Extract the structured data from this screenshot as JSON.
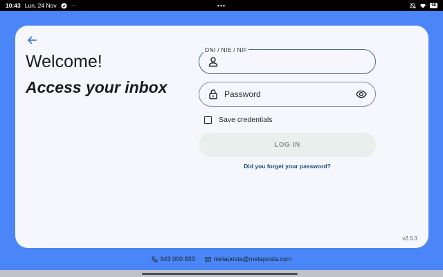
{
  "status_bar": {
    "time": "10:43",
    "date": "Lun, 24 Nov",
    "center_dots": "•••",
    "left_dots": "···",
    "battery": "98"
  },
  "welcome": {
    "title": "Welcome!",
    "subtitle": "Access your inbox"
  },
  "form": {
    "dni_label": "DNI / NIE / NIF",
    "dni_value": "",
    "password_placeholder": "Password",
    "save_credentials_label": "Save credentials",
    "save_credentials_checked": false,
    "login_label": "LOG IN",
    "forgot_label": "Did you forget your password?"
  },
  "version": "v2.0.3",
  "footer": {
    "phone": "943 000 833",
    "email": "metaposta@metaposta.com"
  },
  "colors": {
    "background": "#4a86f7",
    "card": "#f5f7fc",
    "link": "#1c4a82",
    "back_arrow": "#3d78d6"
  },
  "icons": [
    "back-arrow-icon",
    "person-icon",
    "lock-icon",
    "eye-icon",
    "phone-icon",
    "mail-icon"
  ]
}
